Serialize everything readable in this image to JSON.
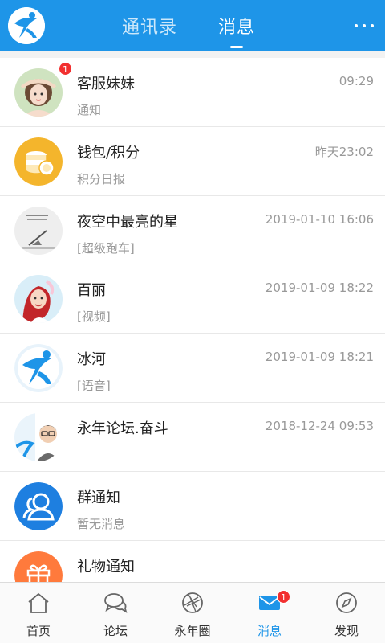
{
  "header": {
    "tabs": [
      {
        "label": "通讯录",
        "active": false
      },
      {
        "label": "消息",
        "active": true
      }
    ]
  },
  "colors": {
    "accent": "#1e95e8",
    "badge": "#f23030"
  },
  "messages": [
    {
      "name": "客服妹妹",
      "subtitle": "通知",
      "time": "09:29",
      "badge": "1",
      "avatar": "girl-photo"
    },
    {
      "name": "钱包/积分",
      "subtitle": "积分日报",
      "time": "昨天23:02",
      "avatar": "coins-icon"
    },
    {
      "name": "夜空中最亮的星",
      "subtitle": "[超级跑车]",
      "time": "2019-01-10 16:06",
      "avatar": "sketch-photo"
    },
    {
      "name": "百丽",
      "subtitle": "[视频]",
      "time": "2019-01-09 18:22",
      "avatar": "woman-photo"
    },
    {
      "name": "冰河",
      "subtitle": "[语音]",
      "time": "2019-01-09 18:21",
      "avatar": "runner-logo"
    },
    {
      "name": "永年论坛.奋斗",
      "subtitle": "",
      "time": "2018-12-24 09:53",
      "avatar": "cartoon-photo"
    },
    {
      "name": "群通知",
      "subtitle": "暂无消息",
      "time": "",
      "avatar": "group-icon"
    },
    {
      "name": "礼物通知",
      "subtitle": "",
      "time": "",
      "avatar": "gift-icon"
    }
  ],
  "nav": [
    {
      "label": "首页",
      "icon": "home-icon"
    },
    {
      "label": "论坛",
      "icon": "chat-bubbles-icon"
    },
    {
      "label": "永年圈",
      "icon": "aperture-icon"
    },
    {
      "label": "消息",
      "icon": "mail-icon",
      "active": true,
      "badge": "1"
    },
    {
      "label": "发现",
      "icon": "compass-icon"
    }
  ]
}
